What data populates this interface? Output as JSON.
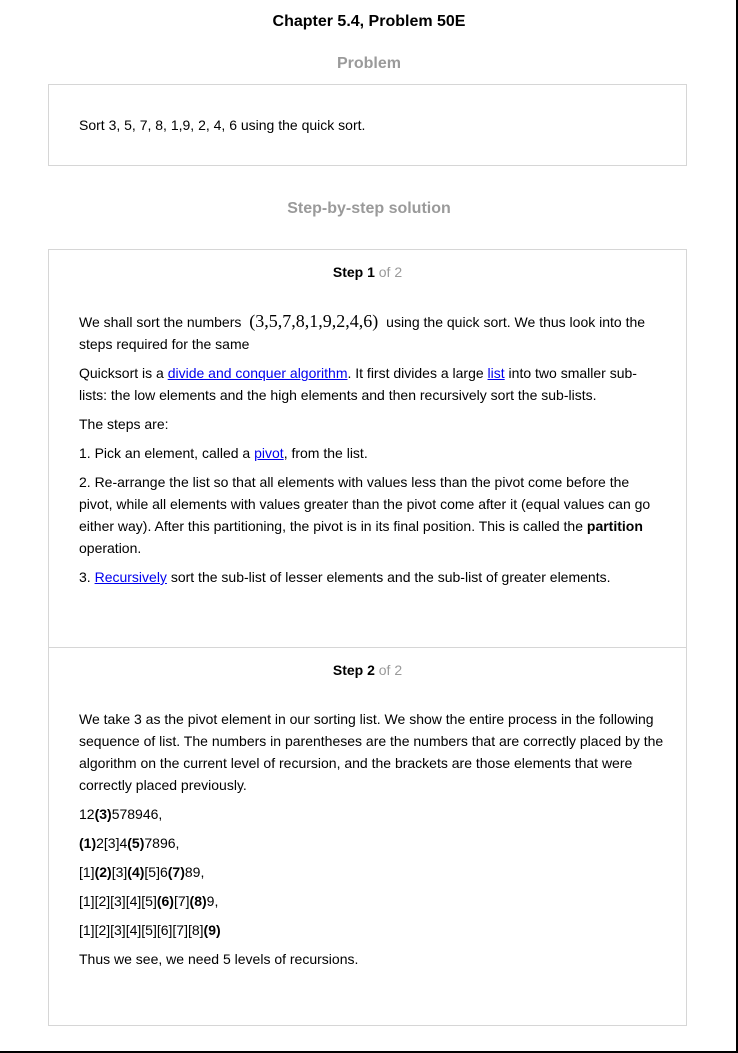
{
  "chapter_title": "Chapter 5.4, Problem 50E",
  "problem": {
    "heading": "Problem",
    "text": "Sort 3, 5, 7, 8, 1,9, 2, 4, 6 using the quick sort."
  },
  "solution": {
    "heading": "Step-by-step solution",
    "step1": {
      "label": "Step 1",
      "of": "of 2",
      "intro_a": "We shall sort the numbers",
      "math": "(3,5,7,8,1,9,2,4,6)",
      "intro_b": "using the quick sort. We thus look into the steps required for the same",
      "qs_a": "Quicksort is a ",
      "qs_link1": "divide and conquer algorithm",
      "qs_b": ". It first divides a large ",
      "qs_link2": "list",
      "qs_c": " into two smaller sub-lists: the low elements and the high elements and then recursively sort the sub-lists.",
      "steps_are": "The steps are:",
      "s1_a": "1. Pick an element, called a ",
      "s1_link": "pivot",
      "s1_b": ", from the list.",
      "s2_a": "2. Re-arrange the list so that all elements with values less than the pivot come before the pivot, while all elements with values greater than the pivot come after it (equal values can go either way). After this partitioning, the pivot is in its final position. This is called the ",
      "s2_bold": "partition",
      "s2_b": " operation.",
      "s3_a": "3. ",
      "s3_link": "Recursively",
      "s3_b": " sort the sub-list of lesser elements and the sub-list of greater elements."
    },
    "step2": {
      "label": "Step 2",
      "of": "of 2",
      "intro": "We take 3 as the pivot element in our sorting list. We show the entire process in the following sequence of list. The numbers in parentheses are the numbers that are correctly placed by the algorithm on the current level of recursion, and the brackets are those elements that were correctly placed previously.",
      "line1": {
        "p1": "12",
        "b1": "(3)",
        "p2": "578946,"
      },
      "line2": {
        "b1": "(1)",
        "p1": "2[3]4",
        "b2": "(5)",
        "p2": "7896,"
      },
      "line3": {
        "p1": "[1]",
        "b1": "(2)",
        "p2": "[3]",
        "b2": "(4)",
        "p3": "[5]6",
        "b3": "(7)",
        "p4": "89,"
      },
      "line4": {
        "p1": "[1][2][3][4][5]",
        "b1": "(6)",
        "p2": "[7]",
        "b2": "(8)",
        "p3": "9,"
      },
      "line5": {
        "p1": "[1][2][3][4][5][6][7][8]",
        "b1": "(9)"
      },
      "conclusion": "Thus we see, we need 5 levels of recursions."
    }
  }
}
